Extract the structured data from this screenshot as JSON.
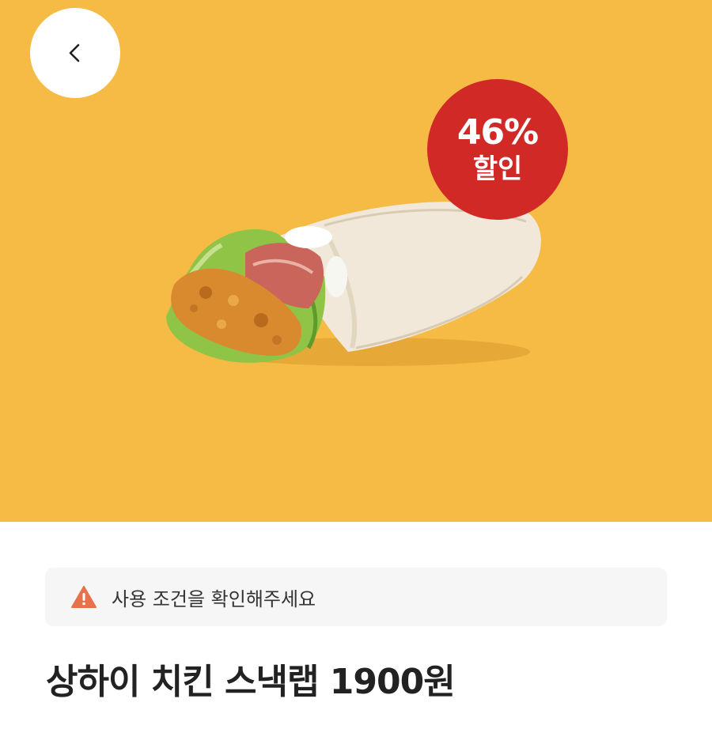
{
  "header": {
    "back_icon": "chevron-left-icon"
  },
  "hero": {
    "background_color": "#f5bb45",
    "image": "chicken-snack-wrap",
    "badge": {
      "percent": "46%",
      "label": "할인",
      "color": "#d12a26"
    }
  },
  "notice": {
    "icon": "warning-icon",
    "text": "사용 조건을 확인해주세요"
  },
  "product": {
    "title": "상하이 치킨 스낵랩 1900원"
  }
}
